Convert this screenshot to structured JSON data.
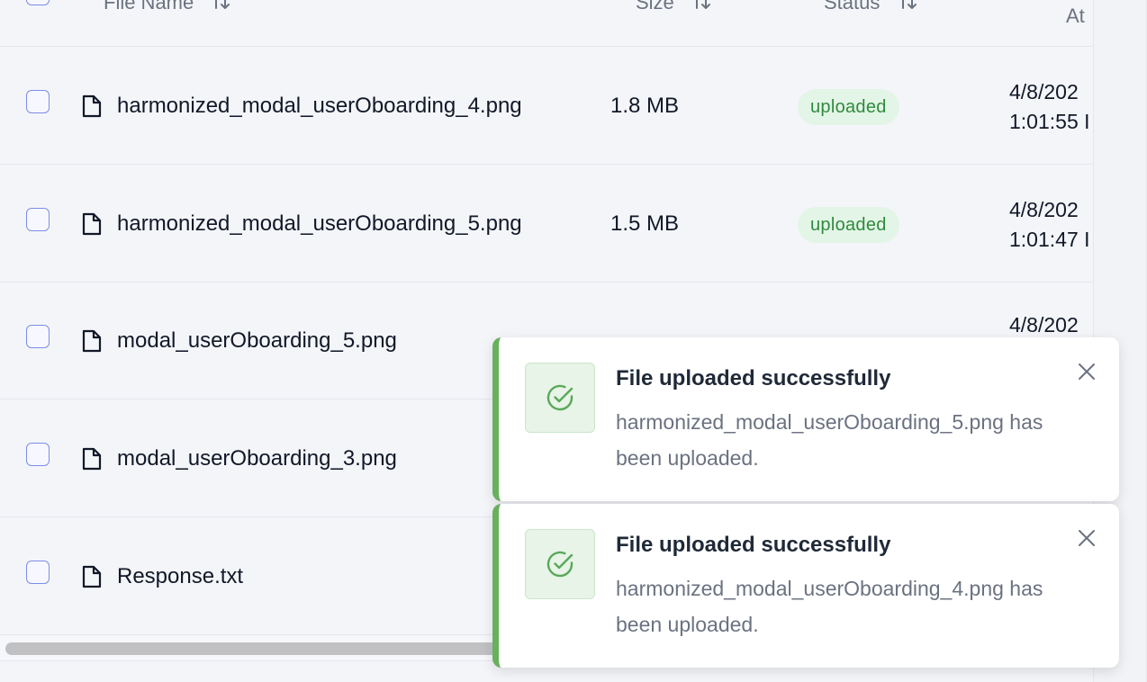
{
  "table": {
    "headers": {
      "file_name": "File Name",
      "size": "Size",
      "status": "Status",
      "uploaded_at": "At"
    },
    "rows": [
      {
        "name": "harmonized_modal_userOboarding_4.png",
        "size": "1.8 MB",
        "status": "uploaded",
        "date_line1": "4/8/202",
        "date_line2": "1:01:55 I"
      },
      {
        "name": "harmonized_modal_userOboarding_5.png",
        "size": "1.5 MB",
        "status": "uploaded",
        "date_line1": "4/8/202",
        "date_line2": "1:01:47 I"
      },
      {
        "name": "modal_userOboarding_5.png",
        "size": "",
        "status": "",
        "date_line1": "4/8/202",
        "date_line2": ""
      },
      {
        "name": "modal_userOboarding_3.png",
        "size": "",
        "status": "",
        "date_line1": "",
        "date_line2": ""
      },
      {
        "name": "Response.txt",
        "size": "",
        "status": "",
        "date_line1": "",
        "date_line2": ""
      }
    ]
  },
  "toasts": [
    {
      "title": "File uploaded successfully",
      "message": "harmonized_modal_userOboarding_5.png has been uploaded.",
      "icon": "check-circle-icon"
    },
    {
      "title": "File uploaded successfully",
      "message": "harmonized_modal_userOboarding_4.png has been uploaded.",
      "icon": "check-circle-icon"
    }
  ],
  "colors": {
    "success_accent": "#67b05d",
    "badge_bg": "#e3f5e6",
    "badge_text": "#2f8a3e",
    "checkbox_border": "#7b8de8"
  }
}
